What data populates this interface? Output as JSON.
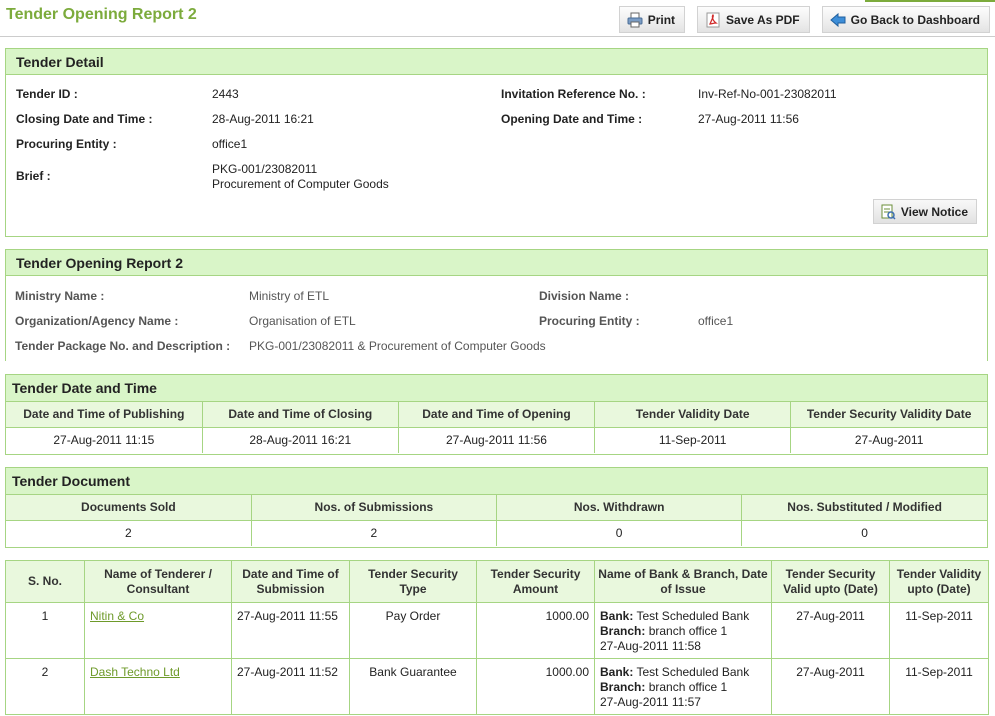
{
  "header": {
    "title": "Tender Opening Report 2",
    "print_label": "Print",
    "pdf_label": "Save As PDF",
    "back_label": "Go Back to Dashboard"
  },
  "tender_detail": {
    "heading": "Tender Detail",
    "tender_id_label": "Tender ID :",
    "tender_id": "2443",
    "invitation_ref_label": "Invitation Reference No. :",
    "invitation_ref": "Inv-Ref-No-001-23082011",
    "closing_label": "Closing Date and Time :",
    "closing": "28-Aug-2011 16:21",
    "opening_label": "Opening Date and Time :",
    "opening": "27-Aug-2011 11:56",
    "procuring_entity_label": "Procuring Entity :",
    "procuring_entity": "office1",
    "brief_label": "Brief :",
    "brief_line1": "PKG-001/23082011",
    "brief_line2": "Procurement of Computer Goods",
    "view_notice_label": "View Notice"
  },
  "report": {
    "heading": "Tender Opening Report 2",
    "ministry_label": "Ministry Name :",
    "ministry": "Ministry of ETL",
    "division_label": "Division Name :",
    "division": "",
    "org_label": "Organization/Agency Name :",
    "org": "Organisation of ETL",
    "procuring_label": "Procuring Entity :",
    "procuring": "office1",
    "package_label": "Tender Package No. and Description :",
    "package": "PKG-001/23082011 & Procurement of Computer Goods"
  },
  "date_time": {
    "heading": "Tender Date and Time",
    "columns": [
      "Date and Time of Publishing",
      "Date and Time of Closing",
      "Date and Time of Opening",
      "Tender Validity Date",
      "Tender Security Validity Date"
    ],
    "values": [
      "27-Aug-2011 11:15",
      "28-Aug-2011 16:21",
      "27-Aug-2011 11:56",
      "11-Sep-2011",
      "27-Aug-2011"
    ]
  },
  "document": {
    "heading": "Tender Document",
    "columns": [
      "Documents Sold",
      "Nos. of Submissions",
      "Nos. Withdrawn",
      "Nos. Substituted / Modified"
    ],
    "values": [
      "2",
      "2",
      "0",
      "0"
    ]
  },
  "bids": {
    "columns": {
      "sno": "S. No.",
      "tenderer": "Name of Tenderer / Consultant",
      "submission": "Date and Time of Submission",
      "sec_type": "Tender Security Type",
      "sec_amount": "Tender Security Amount",
      "bank": "Name of Bank & Branch, Date of Issue",
      "sec_valid": "Tender Security Valid upto (Date)",
      "validity": "Tender Validity upto (Date)"
    },
    "bank_prefix": "Bank:",
    "branch_prefix": "Branch:",
    "rows": [
      {
        "sno": "1",
        "tenderer": "Nitin & Co",
        "submission": "27-Aug-2011 11:55",
        "sec_type": "Pay Order",
        "sec_amount": "1000.00",
        "bank": "Test Scheduled Bank",
        "branch": "branch office 1",
        "issue": "27-Aug-2011 11:58",
        "sec_valid": "27-Aug-2011",
        "validity": "11-Sep-2011"
      },
      {
        "sno": "2",
        "tenderer": "Dash Techno Ltd",
        "submission": "27-Aug-2011 11:52",
        "sec_type": "Bank Guarantee",
        "sec_amount": "1000.00",
        "bank": "Test Scheduled Bank",
        "branch": "branch office 1",
        "issue": "27-Aug-2011 11:57",
        "sec_valid": "27-Aug-2011",
        "validity": "11-Sep-2011"
      }
    ]
  },
  "icons": {
    "print": "printer-icon",
    "pdf": "pdf-icon",
    "back": "back-arrow-icon",
    "notice": "document-view-icon"
  },
  "colors": {
    "accent": "#7cab3c",
    "panel_header": "#d9f5c8",
    "table_header": "#e9f8dd",
    "border": "#a6d583",
    "link": "#6e9a2a"
  }
}
